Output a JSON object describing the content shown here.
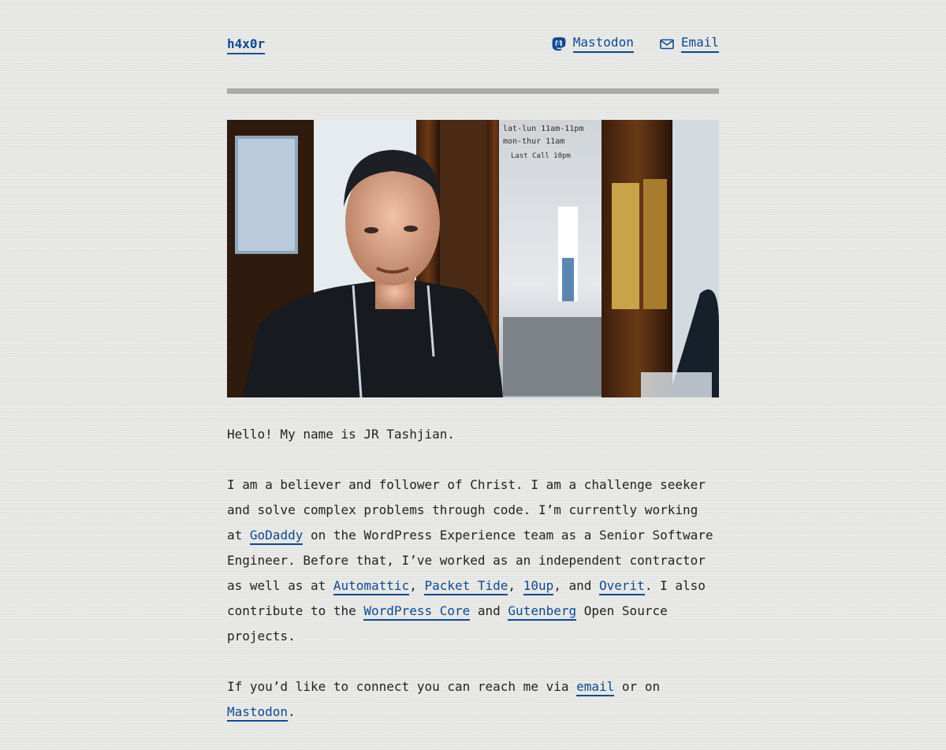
{
  "site": {
    "title": "h4x0r"
  },
  "nav": {
    "mastodon_label": "Mastodon",
    "email_label": "Email",
    "mastodon_icon": "mastodon-icon",
    "email_icon": "envelope-icon"
  },
  "colors": {
    "link": "#0d4a8f",
    "divider": "#a9aaa8",
    "text": "#222222"
  },
  "hero": {
    "image": "photo-of-person-in-hoodie"
  },
  "content": {
    "greeting": "Hello! My name is JR Tashjian.",
    "intro": {
      "t1": "I am a believer and follower of Christ. I am a challenge seeker and solve complex problems through code. I’m currently working at ",
      "godaddy": "GoDaddy",
      "t2": " on the WordPress Experience team as a Senior Software Engineer. Before that, I’ve worked as an independent contractor as well as at ",
      "automattic": "Automattic",
      "t3": ", ",
      "packettide": "Packet Tide",
      "t4": ", ",
      "tenup": "10up",
      "t5": ", and ",
      "overit": "Overit",
      "t6": ". I also contribute to the ",
      "wpcore": "WordPress Core",
      "t7": " and ",
      "gutenberg": "Gutenberg",
      "t8": " Open Source projects."
    },
    "connect": {
      "t1": "If you’d like to connect you can reach me via ",
      "email": "email",
      "t2": " or on ",
      "mastodon": "Mastodon",
      "t3": "."
    }
  }
}
